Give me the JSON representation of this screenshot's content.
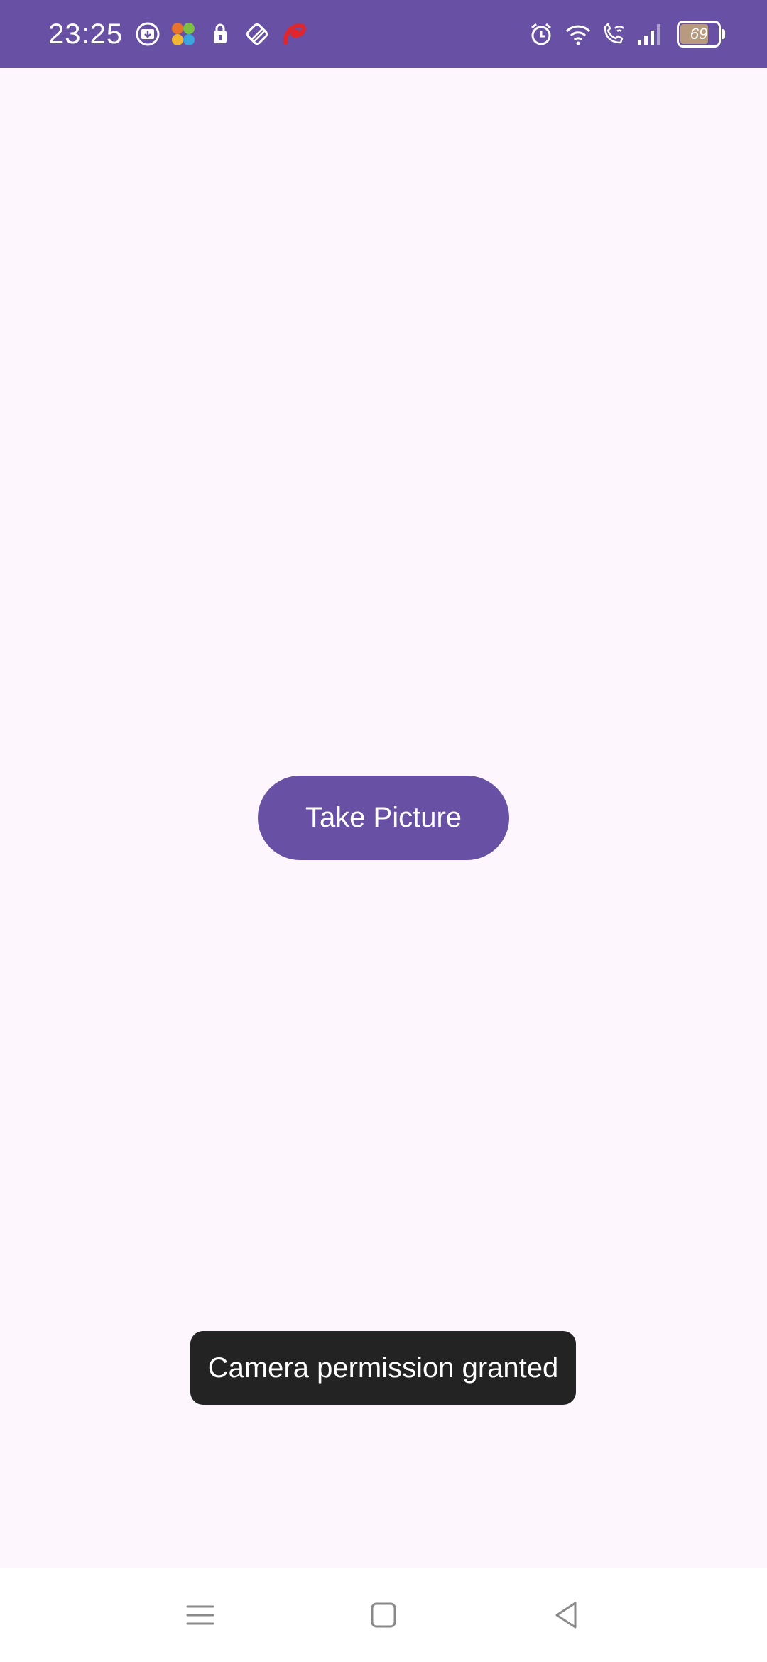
{
  "status_bar": {
    "time": "23:25",
    "battery_level": "69",
    "background_color": "#6851a4",
    "left_icons": [
      "download-icon",
      "app-launcher-icon",
      "shopping-bag-icon",
      "no-sim-icon",
      "airtel-icon"
    ],
    "right_icons": [
      "alarm-icon",
      "wifi-icon",
      "wifi-calling-icon",
      "signal-icon",
      "battery-icon"
    ]
  },
  "main": {
    "take_picture_label": "Take Picture",
    "accent_color": "#6851a4"
  },
  "toast": {
    "message": "Camera permission granted"
  },
  "nav_bar": {
    "items": [
      "menu-icon",
      "home-icon",
      "back-icon"
    ]
  }
}
